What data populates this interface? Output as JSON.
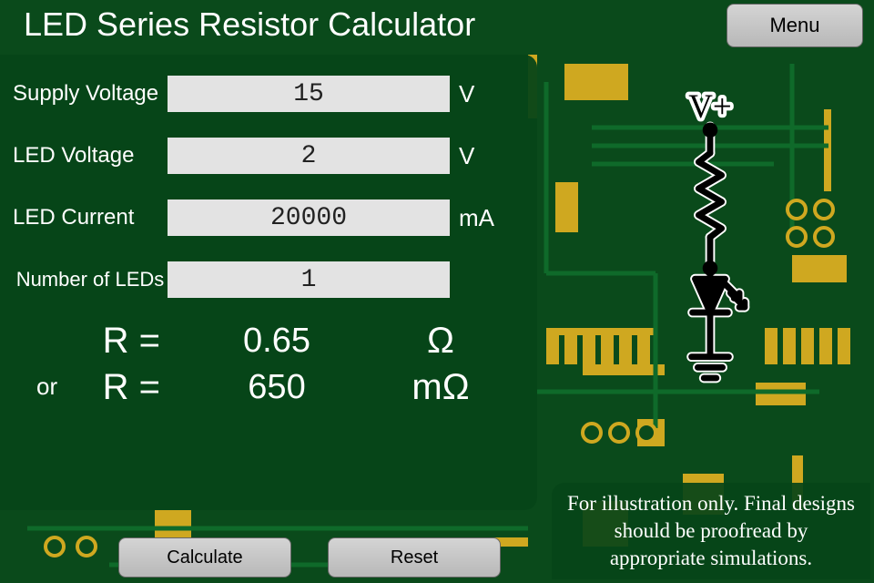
{
  "app": {
    "title": "LED Series Resistor Calculator"
  },
  "buttons": {
    "menu": "Menu",
    "calculate": "Calculate",
    "reset": "Reset"
  },
  "inputs": {
    "supply_voltage": {
      "label": "Supply Voltage",
      "value": "15",
      "unit": "V"
    },
    "led_voltage": {
      "label": "LED Voltage",
      "value": "2",
      "unit": "V"
    },
    "led_current": {
      "label": "LED Current",
      "value": "20000",
      "unit": "mA"
    },
    "num_leds": {
      "label": "Number of LEDs",
      "value": "1",
      "unit": ""
    }
  },
  "results": {
    "or_label": "or",
    "r_symbol": "R =",
    "primary": {
      "value": "0.65",
      "unit": "Ω"
    },
    "secondary": {
      "value": "650",
      "unit": "mΩ"
    }
  },
  "schematic": {
    "vplus_label": "V+"
  },
  "disclaimer": "For illustration only. Final designs should be proofread by appropriate simulations."
}
